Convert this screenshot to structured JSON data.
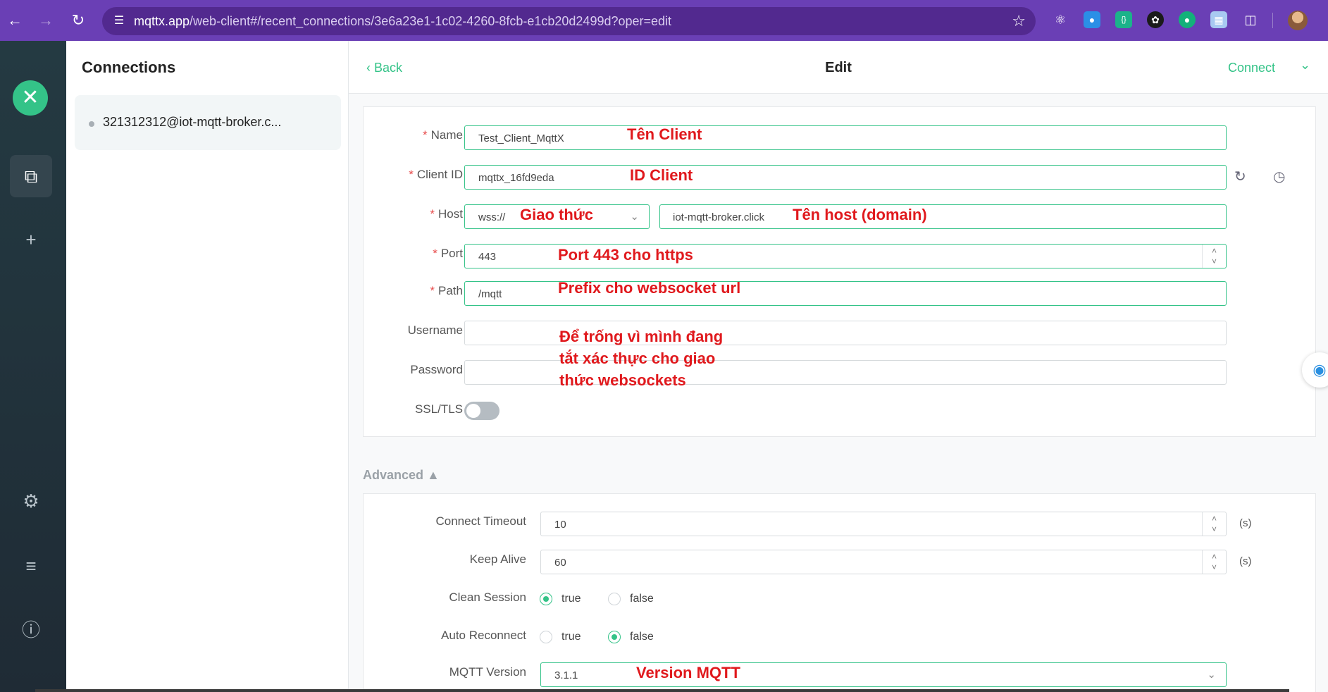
{
  "browser": {
    "url_host": "mqttx.app",
    "url_path": "/web-client#/recent_connections/3e6a23e1-1c02-4260-8fcb-e1cb20d2499d?oper=edit"
  },
  "connections": {
    "title": "Connections",
    "items": [
      {
        "name": "321312312@iot-mqtt-broker.c..."
      }
    ]
  },
  "topbar": {
    "back_label": "Back",
    "title": "Edit",
    "connect_label": "Connect"
  },
  "form": {
    "name": {
      "label": "Name",
      "value": "Test_Client_MqttX"
    },
    "client_id": {
      "label": "Client ID",
      "value": "mqttx_16fd9eda"
    },
    "host": {
      "label": "Host",
      "protocol": "wss://",
      "value": "iot-mqtt-broker.click"
    },
    "port": {
      "label": "Port",
      "value": "443"
    },
    "path": {
      "label": "Path",
      "value": "/mqtt"
    },
    "username": {
      "label": "Username",
      "value": ""
    },
    "password": {
      "label": "Password",
      "value": ""
    },
    "ssl": {
      "label": "SSL/TLS",
      "enabled": false
    }
  },
  "advanced": {
    "label": "Advanced",
    "connect_timeout": {
      "label": "Connect Timeout",
      "value": "10",
      "unit": "(s)"
    },
    "keep_alive": {
      "label": "Keep Alive",
      "value": "60",
      "unit": "(s)"
    },
    "clean_session": {
      "label": "Clean Session",
      "opt_true": "true",
      "opt_false": "false",
      "selected": "true"
    },
    "auto_reconnect": {
      "label": "Auto Reconnect",
      "opt_true": "true",
      "opt_false": "false",
      "selected": "false"
    },
    "mqtt_version": {
      "label": "MQTT Version",
      "value": "3.1.1"
    }
  },
  "annotations": {
    "name": "Tên Client",
    "client_id": "ID Client",
    "protocol": "Giao thức",
    "host": "Tên host (domain)",
    "port": "Port 443 cho https",
    "path": "Prefix cho websocket url",
    "auth_line1": "Để trống vì mình đang",
    "auth_line2": "tắt xác thực cho giao",
    "auth_line3": "thức websockets",
    "mqtt_version": "Version MQTT"
  },
  "colors": {
    "accent": "#34c388",
    "browser": "#6a3fb5",
    "annotation": "#e0191d"
  }
}
